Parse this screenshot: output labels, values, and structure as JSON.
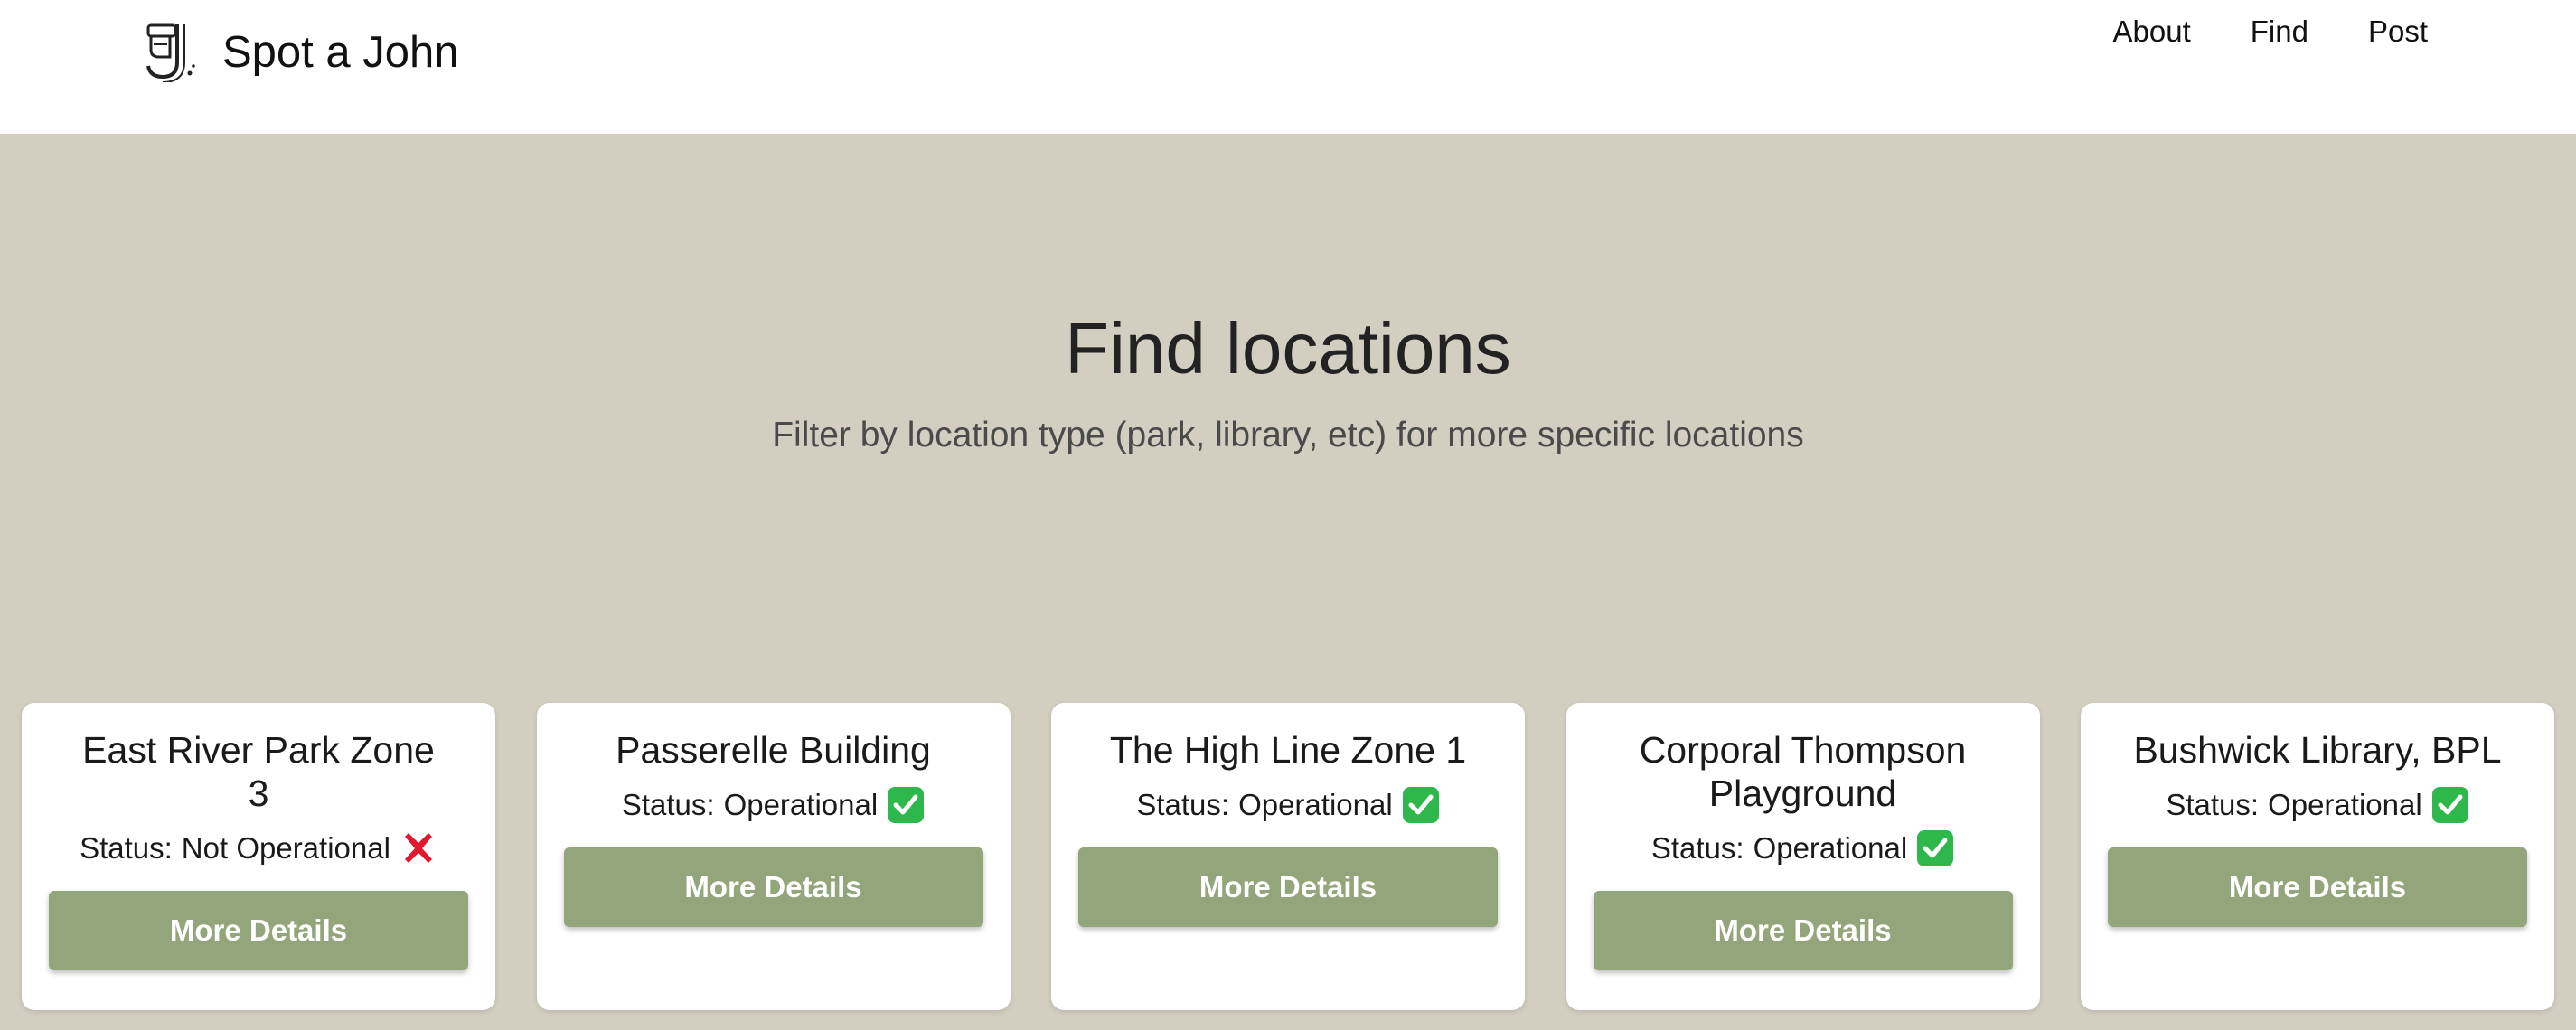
{
  "app": {
    "name": "Spot a John",
    "logo_icon": "toilet-j-logo-icon"
  },
  "nav": {
    "items": [
      {
        "label": "About"
      },
      {
        "label": "Find"
      },
      {
        "label": "Post"
      }
    ]
  },
  "hero": {
    "title": "Find locations",
    "subtitle": "Filter by location type (park, library, etc) for more specific locations"
  },
  "colors": {
    "page_background": "#d2cfc1",
    "button_green": "#93a57a",
    "status_ok_green": "#2eb84b",
    "status_bad_red": "#e0182d"
  },
  "locations": [
    {
      "name": "East River Park Zone 3",
      "status_prefix": "Status:",
      "status": "Not Operational",
      "status_icon": "cross-mark-icon",
      "button_label": "More Details"
    },
    {
      "name": "Passerelle Building",
      "status_prefix": "Status:",
      "status": "Operational",
      "status_icon": "check-mark-icon",
      "button_label": "More Details"
    },
    {
      "name": "The High Line Zone 1",
      "status_prefix": "Status:",
      "status": "Operational",
      "status_icon": "check-mark-icon",
      "button_label": "More Details"
    },
    {
      "name": "Corporal Thompson Playground",
      "status_prefix": "Status:",
      "status": "Operational",
      "status_icon": "check-mark-icon",
      "button_label": "More Details"
    },
    {
      "name": "Bushwick Library, BPL",
      "status_prefix": "Status:",
      "status": "Operational",
      "status_icon": "check-mark-icon",
      "button_label": "More Details"
    }
  ]
}
